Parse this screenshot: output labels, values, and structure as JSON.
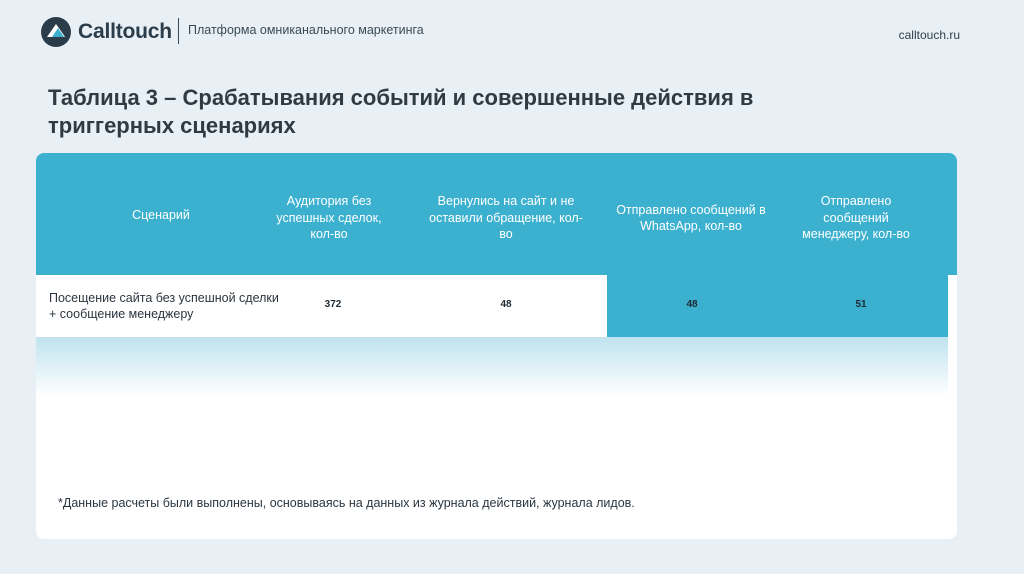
{
  "header": {
    "logo_text": "Calltouch",
    "tagline": "Платформа омниканального маркетинга",
    "site": "calltouch.ru"
  },
  "title": "Таблица 3 – Срабатывания событий и совершенные действия в триггерных сценариях",
  "table": {
    "columns": [
      "Сценарий",
      "Аудитория без успешных сделок, кол-во",
      "Вернулись на сайт и не оставили обращение, кол-во",
      "Отправлено сообщений в WhatsApp, кол-во",
      "Отправлено сообщений менеджеру, кол-во"
    ],
    "rows": [
      {
        "scenario": "Посещение сайта без успешной сделки + сообщение менеджеру",
        "audience": "372",
        "returned": "48",
        "whatsapp": "48",
        "manager": "51"
      }
    ]
  },
  "footnote": "*Данные расчеты были выполнены, основываясь на данных из журнала действий, журнала лидов.",
  "colors": {
    "accent": "#3cb0cf",
    "background": "#e8f0f6",
    "logo": "#2b3d4a"
  },
  "icons": {
    "logo": "calltouch-logo-icon"
  }
}
